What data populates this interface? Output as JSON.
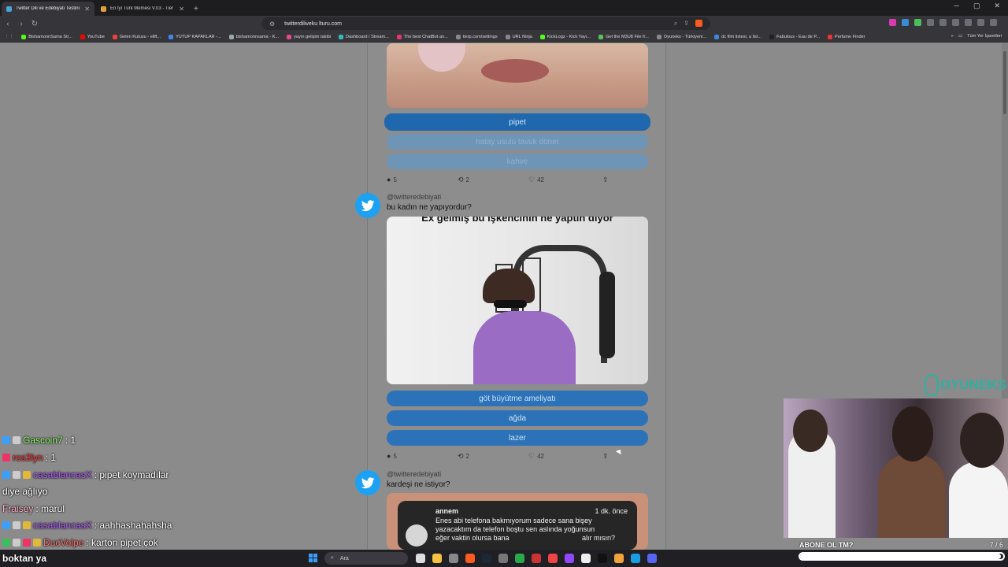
{
  "browser": {
    "tabs": [
      {
        "title": "Twitter Dili ve Edebiyatı Testini Y...",
        "active": true
      },
      {
        "title": "En İyi Türk Memesi V.03 - Tier List, Ki...",
        "active": false
      }
    ],
    "url": "twitterdiliveku lturu.com",
    "bookmarks": [
      "BishamonnSama Str...",
      "YouTube",
      "Gelen Kutusu - elift...",
      "YUTUP KAPAKLAR -...",
      "bishamonnsama - K...",
      "yayın gelişim takibi",
      "Dashboard / Stream...",
      "The best ChatBot an...",
      "tierp.com/settings",
      "URL Ninja",
      "KickLogz - Kick Yayı...",
      "Get the M3U8 File fr...",
      "Oyuneks - Türkiyeni...",
      "dc film listesi, a list...",
      "Fabulous - Eau de P...",
      "Perfume Finder"
    ],
    "bookmarks_right": "Tüm Yer İşaretleri"
  },
  "feed": {
    "post1": {
      "options": [
        "pipet",
        "hatay usulü tavuk döner",
        "kahve"
      ],
      "comments": "5",
      "retweets": "2",
      "likes": "42"
    },
    "post2": {
      "handle": "@twitteredebiyati",
      "question": "bu kadın ne yapıyordur?",
      "caption": "Ex gelmiş bu işkencinin ne yaptın diyor",
      "options": [
        "göt büyütme ameliyatı",
        "ağda",
        "lazer"
      ],
      "comments": "5",
      "retweets": "2",
      "likes": "42"
    },
    "post3": {
      "handle": "@twitteredebiyati",
      "question": "kardeşi ne istiyor?",
      "notification": {
        "from": "annem",
        "when": "1 dk. önce",
        "line1": "Enes abi telefona bakmıyorum sadece sana bişey",
        "line2": "yazacaktım da telefon boştu sen aslında yoğunsun",
        "line3": "eğer vaktin olursa bana",
        "line3b": "alır mısın?"
      }
    }
  },
  "chat": [
    {
      "user": "Gascoin7",
      "msg": ": 1"
    },
    {
      "user": "ros3lyn",
      "msg": ": 1"
    },
    {
      "user": "casablancasX",
      "msg": ": pipet koymadılar"
    },
    {
      "user": "",
      "msg": "diye ağlıyo"
    },
    {
      "user": "Fraisey",
      "msg": ": marul"
    },
    {
      "user": "casablancasX",
      "msg": ": aahhashahahsha"
    },
    {
      "user": "DucVolpe",
      "msg": ": karton pipet çok"
    },
    {
      "user": "",
      "msg": "boktan ya"
    }
  ],
  "stream": {
    "logo": "OYUNEKS",
    "footer_text": "ABONE OL TM?",
    "counter": "7 / 6"
  },
  "taskbar": {
    "search_placeholder": "Ara"
  },
  "colors": {
    "option_blue": "#2b72b8",
    "twitter_blue": "#1da1f2",
    "chat_green": "#8fff6e",
    "chat_purple": "#b25bff"
  }
}
